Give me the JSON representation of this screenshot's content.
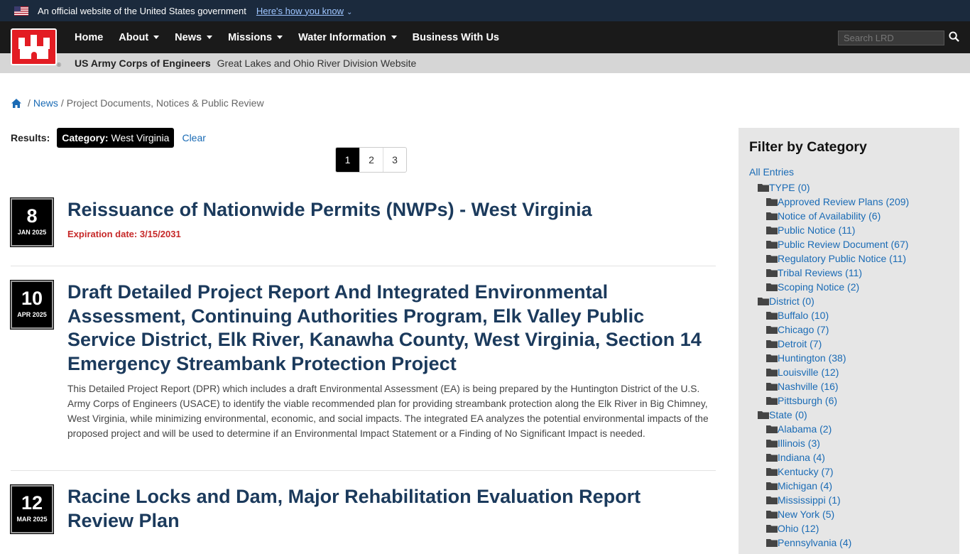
{
  "gov_banner": {
    "text": "An official website of the United States government",
    "link": "Here's how you know"
  },
  "nav": {
    "items": [
      {
        "label": "Home",
        "dropdown": false
      },
      {
        "label": "About",
        "dropdown": true
      },
      {
        "label": "News",
        "dropdown": true
      },
      {
        "label": "Missions",
        "dropdown": true
      },
      {
        "label": "Water Information",
        "dropdown": true
      },
      {
        "label": "Business With Us",
        "dropdown": false
      }
    ],
    "search_placeholder": "Search LRD"
  },
  "sub_bar": {
    "org": "US Army Corps of Engineers",
    "site": "Great Lakes and Ohio River Division Website"
  },
  "breadcrumb": {
    "sep": "/",
    "link": "News",
    "current": "Project Documents, Notices & Public Review"
  },
  "results": {
    "label": "Results:",
    "category_key": "Category:",
    "category_value": "West Virginia",
    "clear": "Clear"
  },
  "pagination": [
    "1",
    "2",
    "3"
  ],
  "articles": [
    {
      "day": "8",
      "month": "JAN 2025",
      "title": "Reissuance of Nationwide Permits (NWPs) - West Virginia",
      "expiration": "Expiration date: 3/15/2031"
    },
    {
      "day": "10",
      "month": "APR 2025",
      "title": "Draft Detailed Project Report And Integrated Environmental Assessment, Continuing Authorities Program, Elk Valley Public Service District, Elk River, Kanawha County, West Virginia, Section 14 Emergency Streambank Protection Project",
      "description": "This Detailed Project Report (DPR) which includes a draft Environmental Assessment (EA) is being prepared by the Huntington District of the U.S. Army Corps of Engineers (USACE) to identify the viable recommended plan for providing streambank protection along the Elk River in Big Chimney, West Virginia, while minimizing environmental, economic, and social impacts. The integrated EA analyzes the potential environmental impacts of the proposed project and will be used to determine if an Environmental Impact Statement or a Finding of No Significant Impact is needed."
    },
    {
      "day": "12",
      "month": "MAR 2025",
      "title": "Racine Locks and Dam, Major Rehabilitation Evaluation Report Review Plan"
    }
  ],
  "sidebar": {
    "title": "Filter by Category",
    "all": "All Entries",
    "groups": [
      {
        "label": "TYPE (0)",
        "items": [
          "Approved Review Plans (209)",
          "Notice of Availability (6)",
          "Public Notice (11)",
          "Public Review Document (67)",
          "Regulatory Public Notice (11)",
          "Tribal Reviews (11)",
          "Scoping Notice (2)"
        ]
      },
      {
        "label": "District (0)",
        "items": [
          "Buffalo (10)",
          "Chicago (7)",
          "Detroit (7)",
          "Huntington (38)",
          "Louisville (12)",
          "Nashville (16)",
          "Pittsburgh (6)"
        ]
      },
      {
        "label": "State (0)",
        "items": [
          "Alabama (2)",
          "Illinois (3)",
          "Indiana (4)",
          "Kentucky (7)",
          "Michigan (4)",
          "Mississippi (1)",
          "New York (5)",
          "Ohio (12)",
          "Pennsylvania (4)"
        ]
      }
    ]
  },
  "colors": {
    "banner_bg": "#1b2a3d",
    "nav_bg": "#1a1a1a",
    "logo_red": "#e31c23",
    "title_blue": "#1b3a5c",
    "link_blue": "#1a6bb5",
    "expiration_red": "#c62828",
    "sidebar_bg": "#e6e6e6"
  }
}
